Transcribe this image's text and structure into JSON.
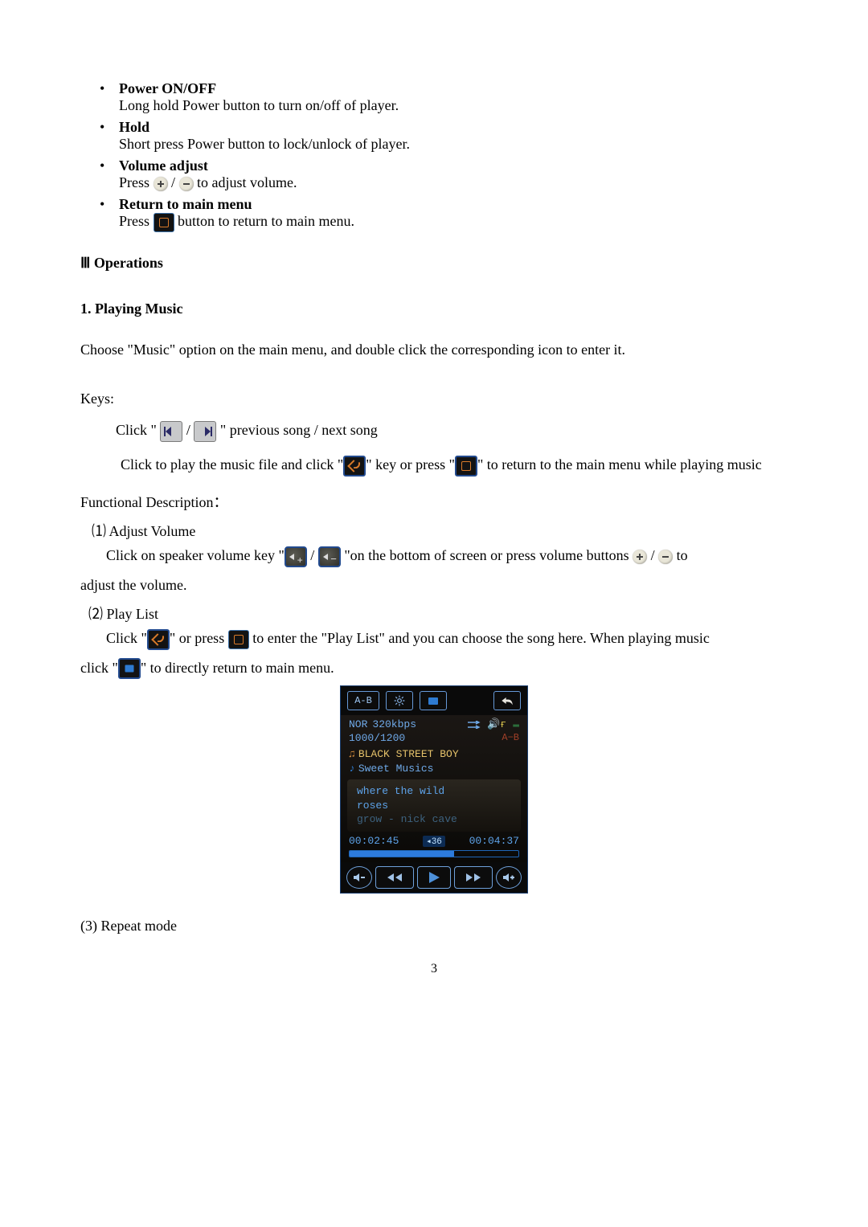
{
  "bullets": {
    "power": {
      "title": "Power ON/OFF",
      "desc": "Long hold Power button to turn on/off of player."
    },
    "hold": {
      "title": "Hold",
      "desc": "Short press Power button to lock/unlock of player."
    },
    "volume": {
      "title": "Volume adjust",
      "prefix": "Press ",
      "separator": " / ",
      "suffix": "  to adjust volume."
    },
    "return": {
      "title": "Return to main menu",
      "prefix": "Press  ",
      "suffix": "  button to return to main menu."
    }
  },
  "section3": "Ⅲ Operations",
  "sub1": "1. Playing Music",
  "intro": "Choose \"Music\" option on the main menu, and double click the corresponding icon to enter it.",
  "keys_label": "Keys:",
  "keys": {
    "row1_prefix": "Click \"  ",
    "row1_sep": "  /  ",
    "row1_suffix": "  \" previous song / next song",
    "row2_a": "Click to play the music file and click \"",
    "row2_b": "\" key or press \"",
    "row2_c": "\" to return to the main menu while playing music"
  },
  "func_desc": "Functional Description：",
  "adj_vol": {
    "title": "⑴ Adjust Volume",
    "a": "Click on speaker volume key \"",
    "sep": " / ",
    "b": "   \"on the bottom of screen or press volume buttons ",
    "c": "  /  ",
    "d": "  to",
    "wrap": "adjust the volume."
  },
  "playlist": {
    "title": "⑵ Play List",
    "a": "Click \"",
    "b": "\" or press  ",
    "c": "  to enter the \"Play List\" and you can choose the song here. When playing music",
    "d": "click \"",
    "e": "\" to directly return to main menu."
  },
  "player": {
    "ab": "A-B",
    "nor": "NOR",
    "bitrate": "320kbps",
    "count": "1000/1200",
    "ab2": "A−B",
    "track": "BLACK STREET BOY",
    "sub": "Sweet Musics",
    "lyric1": "where the wild",
    "lyric2": "roses",
    "lyric3": "grow - nick cave",
    "elapsed": "00:02:45",
    "vol": "◂36",
    "total": "00:04:37"
  },
  "repeat": "(3) Repeat mode",
  "page_number": "3"
}
